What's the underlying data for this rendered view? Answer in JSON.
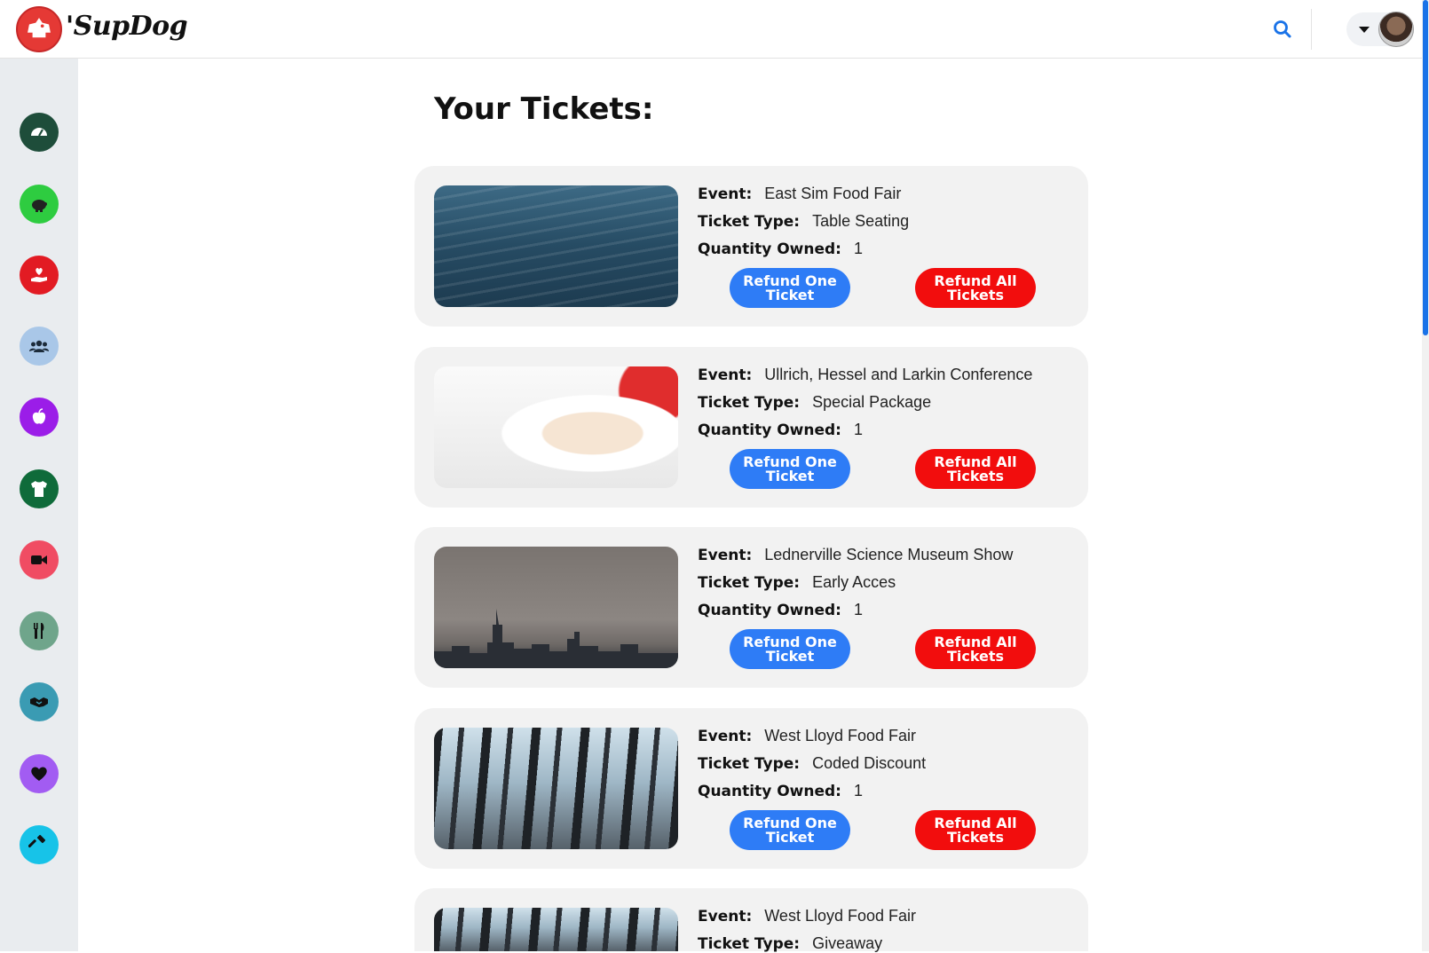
{
  "app": {
    "brand": "'SupDog"
  },
  "header": {
    "search_icon": "search-icon",
    "menu_icon": "chevron-down-icon"
  },
  "sidebar": {
    "items": [
      {
        "icon": "dashboard-icon",
        "color": "#1e4d3a"
      },
      {
        "icon": "piggy-bank-icon",
        "color": "#2ecc40"
      },
      {
        "icon": "hand-heart-icon",
        "color": "#e21b23"
      },
      {
        "icon": "users-icon",
        "color": "#a9c7e8"
      },
      {
        "icon": "apple-icon",
        "color": "#9b1de8"
      },
      {
        "icon": "tshirt-icon",
        "color": "#0f6b3a"
      },
      {
        "icon": "video-icon",
        "color": "#f04c63"
      },
      {
        "icon": "utensils-icon",
        "color": "#6fa58b"
      },
      {
        "icon": "handshake-icon",
        "color": "#3a9bb3"
      },
      {
        "icon": "heart-icon",
        "color": "#a25cf2"
      },
      {
        "icon": "hammer-icon",
        "color": "#17c3e8"
      }
    ]
  },
  "main": {
    "title": "Your Tickets:",
    "labels": {
      "event": "Event:",
      "ticket_type": "Ticket Type:",
      "quantity": "Quantity Owned:"
    },
    "buttons": {
      "refund_one": "Refund One Ticket",
      "refund_all": "Refund All Tickets"
    },
    "tickets": [
      {
        "event": "East Sim Food Fair",
        "ticket_type": "Table Seating",
        "quantity": "1",
        "image": "water"
      },
      {
        "event": "Ullrich, Hessel and Larkin Conference",
        "ticket_type": "Special Package",
        "quantity": "1",
        "image": "bowl"
      },
      {
        "event": "Lednerville Science Museum Show",
        "ticket_type": "Early Acces",
        "quantity": "1",
        "image": "city"
      },
      {
        "event": "West Lloyd Food Fair",
        "ticket_type": "Coded Discount",
        "quantity": "1",
        "image": "forest"
      },
      {
        "event": "West Lloyd Food Fair",
        "ticket_type": "Giveaway",
        "quantity": "",
        "image": "forest"
      }
    ]
  },
  "colors": {
    "accent_blue": "#2e7cf6",
    "danger_red": "#f20d0d",
    "card_bg": "#f2f2f2"
  }
}
